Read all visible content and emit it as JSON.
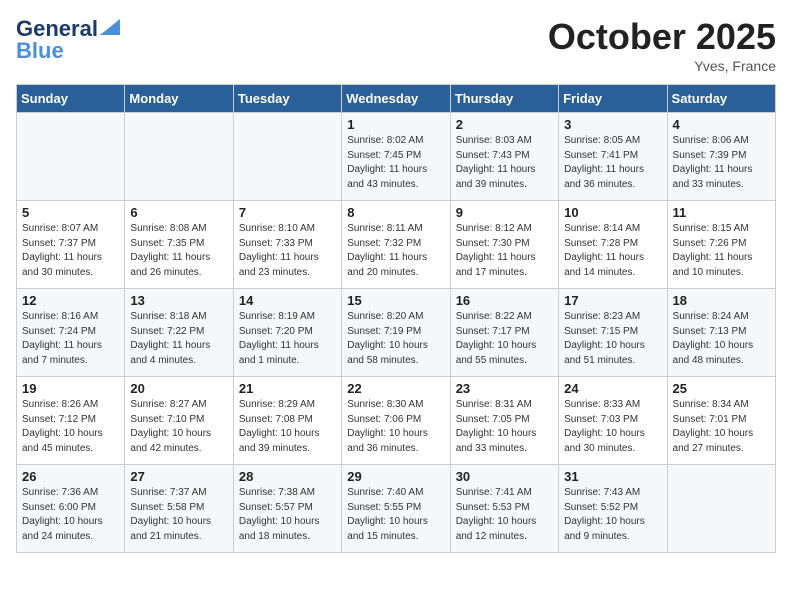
{
  "header": {
    "logo_line1": "General",
    "logo_line2": "Blue",
    "month": "October 2025",
    "location": "Yves, France"
  },
  "weekdays": [
    "Sunday",
    "Monday",
    "Tuesday",
    "Wednesday",
    "Thursday",
    "Friday",
    "Saturday"
  ],
  "weeks": [
    [
      {
        "day": "",
        "info": ""
      },
      {
        "day": "",
        "info": ""
      },
      {
        "day": "",
        "info": ""
      },
      {
        "day": "1",
        "info": "Sunrise: 8:02 AM\nSunset: 7:45 PM\nDaylight: 11 hours\nand 43 minutes."
      },
      {
        "day": "2",
        "info": "Sunrise: 8:03 AM\nSunset: 7:43 PM\nDaylight: 11 hours\nand 39 minutes."
      },
      {
        "day": "3",
        "info": "Sunrise: 8:05 AM\nSunset: 7:41 PM\nDaylight: 11 hours\nand 36 minutes."
      },
      {
        "day": "4",
        "info": "Sunrise: 8:06 AM\nSunset: 7:39 PM\nDaylight: 11 hours\nand 33 minutes."
      }
    ],
    [
      {
        "day": "5",
        "info": "Sunrise: 8:07 AM\nSunset: 7:37 PM\nDaylight: 11 hours\nand 30 minutes."
      },
      {
        "day": "6",
        "info": "Sunrise: 8:08 AM\nSunset: 7:35 PM\nDaylight: 11 hours\nand 26 minutes."
      },
      {
        "day": "7",
        "info": "Sunrise: 8:10 AM\nSunset: 7:33 PM\nDaylight: 11 hours\nand 23 minutes."
      },
      {
        "day": "8",
        "info": "Sunrise: 8:11 AM\nSunset: 7:32 PM\nDaylight: 11 hours\nand 20 minutes."
      },
      {
        "day": "9",
        "info": "Sunrise: 8:12 AM\nSunset: 7:30 PM\nDaylight: 11 hours\nand 17 minutes."
      },
      {
        "day": "10",
        "info": "Sunrise: 8:14 AM\nSunset: 7:28 PM\nDaylight: 11 hours\nand 14 minutes."
      },
      {
        "day": "11",
        "info": "Sunrise: 8:15 AM\nSunset: 7:26 PM\nDaylight: 11 hours\nand 10 minutes."
      }
    ],
    [
      {
        "day": "12",
        "info": "Sunrise: 8:16 AM\nSunset: 7:24 PM\nDaylight: 11 hours\nand 7 minutes."
      },
      {
        "day": "13",
        "info": "Sunrise: 8:18 AM\nSunset: 7:22 PM\nDaylight: 11 hours\nand 4 minutes."
      },
      {
        "day": "14",
        "info": "Sunrise: 8:19 AM\nSunset: 7:20 PM\nDaylight: 11 hours\nand 1 minute."
      },
      {
        "day": "15",
        "info": "Sunrise: 8:20 AM\nSunset: 7:19 PM\nDaylight: 10 hours\nand 58 minutes."
      },
      {
        "day": "16",
        "info": "Sunrise: 8:22 AM\nSunset: 7:17 PM\nDaylight: 10 hours\nand 55 minutes."
      },
      {
        "day": "17",
        "info": "Sunrise: 8:23 AM\nSunset: 7:15 PM\nDaylight: 10 hours\nand 51 minutes."
      },
      {
        "day": "18",
        "info": "Sunrise: 8:24 AM\nSunset: 7:13 PM\nDaylight: 10 hours\nand 48 minutes."
      }
    ],
    [
      {
        "day": "19",
        "info": "Sunrise: 8:26 AM\nSunset: 7:12 PM\nDaylight: 10 hours\nand 45 minutes."
      },
      {
        "day": "20",
        "info": "Sunrise: 8:27 AM\nSunset: 7:10 PM\nDaylight: 10 hours\nand 42 minutes."
      },
      {
        "day": "21",
        "info": "Sunrise: 8:29 AM\nSunset: 7:08 PM\nDaylight: 10 hours\nand 39 minutes."
      },
      {
        "day": "22",
        "info": "Sunrise: 8:30 AM\nSunset: 7:06 PM\nDaylight: 10 hours\nand 36 minutes."
      },
      {
        "day": "23",
        "info": "Sunrise: 8:31 AM\nSunset: 7:05 PM\nDaylight: 10 hours\nand 33 minutes."
      },
      {
        "day": "24",
        "info": "Sunrise: 8:33 AM\nSunset: 7:03 PM\nDaylight: 10 hours\nand 30 minutes."
      },
      {
        "day": "25",
        "info": "Sunrise: 8:34 AM\nSunset: 7:01 PM\nDaylight: 10 hours\nand 27 minutes."
      }
    ],
    [
      {
        "day": "26",
        "info": "Sunrise: 7:36 AM\nSunset: 6:00 PM\nDaylight: 10 hours\nand 24 minutes."
      },
      {
        "day": "27",
        "info": "Sunrise: 7:37 AM\nSunset: 5:58 PM\nDaylight: 10 hours\nand 21 minutes."
      },
      {
        "day": "28",
        "info": "Sunrise: 7:38 AM\nSunset: 5:57 PM\nDaylight: 10 hours\nand 18 minutes."
      },
      {
        "day": "29",
        "info": "Sunrise: 7:40 AM\nSunset: 5:55 PM\nDaylight: 10 hours\nand 15 minutes."
      },
      {
        "day": "30",
        "info": "Sunrise: 7:41 AM\nSunset: 5:53 PM\nDaylight: 10 hours\nand 12 minutes."
      },
      {
        "day": "31",
        "info": "Sunrise: 7:43 AM\nSunset: 5:52 PM\nDaylight: 10 hours\nand 9 minutes."
      },
      {
        "day": "",
        "info": ""
      }
    ]
  ]
}
